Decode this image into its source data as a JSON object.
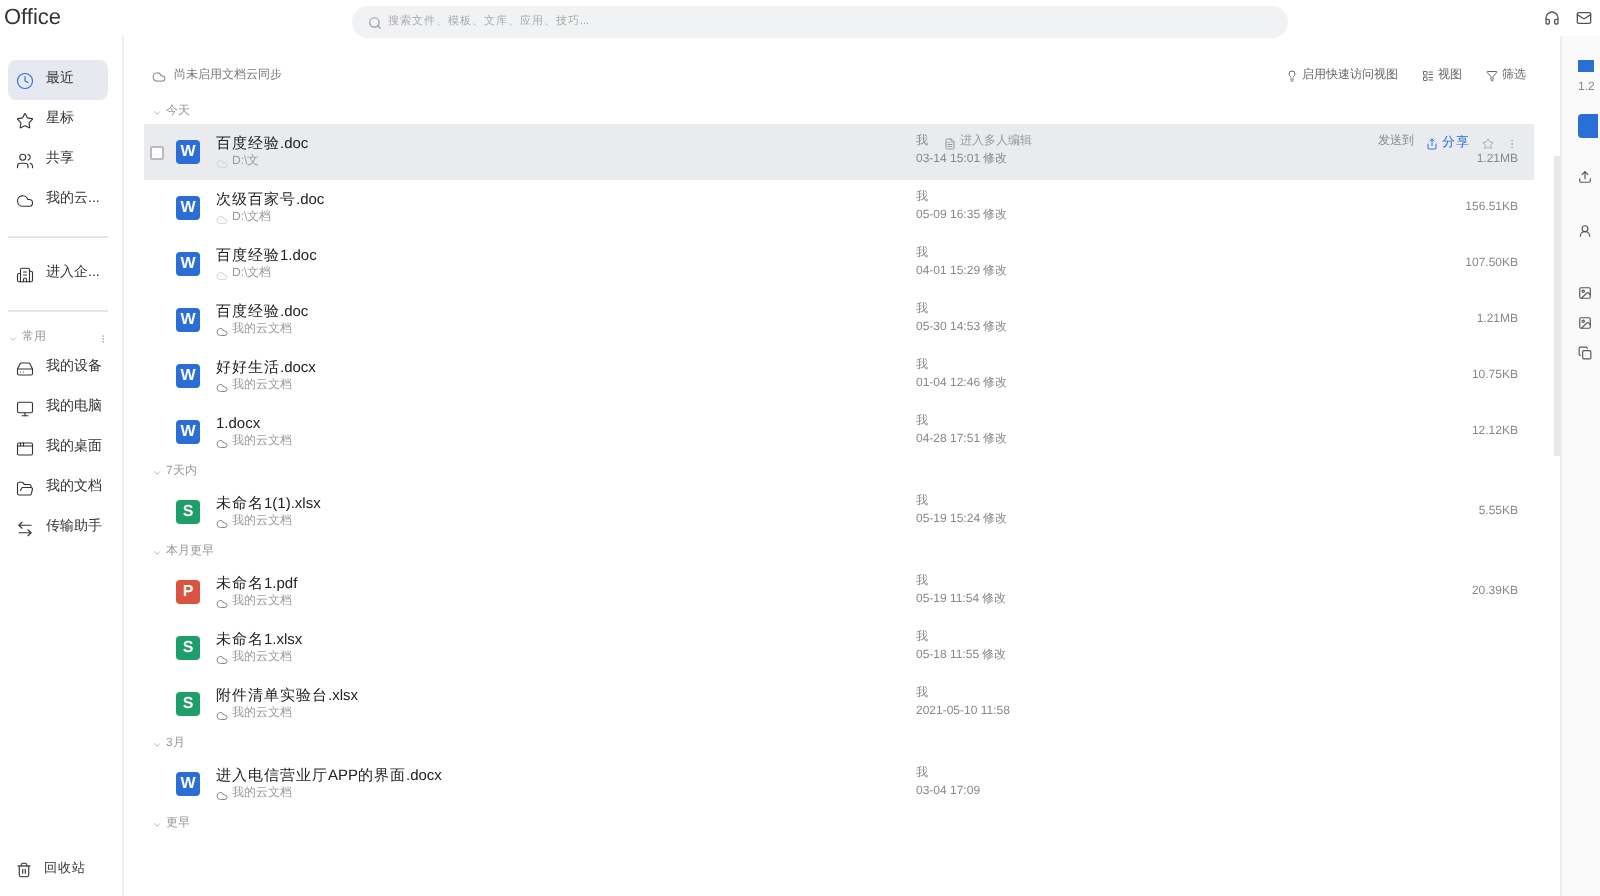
{
  "app": {
    "logo": "Office",
    "search_placeholder": "搜索文件、模板、文库、应用、技巧..."
  },
  "sidebar": {
    "items": [
      {
        "label": "最近",
        "selected": true
      },
      {
        "label": "星标",
        "selected": false
      },
      {
        "label": "共享",
        "selected": false
      },
      {
        "label": "我的云...",
        "selected": false
      }
    ],
    "enterprise": {
      "label": "进入企..."
    },
    "group": {
      "label": "常用",
      "expanded": true,
      "items": [
        {
          "label": "我的设备"
        },
        {
          "label": "我的电脑"
        },
        {
          "label": "我的桌面"
        },
        {
          "label": "我的文档"
        },
        {
          "label": "传输助手"
        }
      ]
    },
    "trash": "回收站"
  },
  "toolbar": {
    "sync": "尚未启用文档云同步",
    "actions": [
      "启用快速访问视图",
      "视图",
      "筛选"
    ]
  },
  "groups": [
    {
      "label": "今天",
      "expanded": true,
      "rows": [
        {
          "kind": "doc",
          "letter": "W",
          "name": "百度经验.doc",
          "location": "D:\\文",
          "cloud": false,
          "owner": "我",
          "time": "03-14 15:01 修改",
          "size": "1.21MB",
          "hovered": true,
          "collab": "进入多人编辑",
          "send": "发送到",
          "share": "分享"
        },
        {
          "kind": "doc",
          "letter": "W",
          "name": "次级百家号.doc",
          "location": "D:\\文档",
          "cloud": false,
          "owner": "我",
          "time": "05-09 16:35 修改",
          "size": "156.51KB",
          "hovered": false
        },
        {
          "kind": "doc",
          "letter": "W",
          "name": "百度经验1.doc",
          "location": "D:\\文档",
          "cloud": false,
          "owner": "我",
          "time": "04-01 15:29 修改",
          "size": "107.50KB",
          "hovered": false
        },
        {
          "kind": "doc",
          "letter": "W",
          "name": "百度经验.doc",
          "location": "我的云文档",
          "cloud": true,
          "owner": "我",
          "time": "05-30 14:53 修改",
          "size": "1.21MB",
          "hovered": false
        },
        {
          "kind": "doc",
          "letter": "W",
          "name": "好好生活.docx",
          "location": "我的云文档",
          "cloud": true,
          "owner": "我",
          "time": "01-04 12:46 修改",
          "size": "10.75KB",
          "hovered": false
        },
        {
          "kind": "doc",
          "letter": "W",
          "name": "1.docx",
          "location": "我的云文档",
          "cloud": true,
          "owner": "我",
          "time": "04-28 17:51 修改",
          "size": "12.12KB",
          "hovered": false
        }
      ]
    },
    {
      "label": "7天内",
      "expanded": true,
      "rows": [
        {
          "kind": "sheet",
          "letter": "S",
          "name": "未命名1(1).xlsx",
          "location": "我的云文档",
          "cloud": true,
          "owner": "我",
          "time": "05-19 15:24 修改",
          "size": "5.55KB",
          "hovered": false
        }
      ]
    },
    {
      "label": "本月更早",
      "expanded": true,
      "rows": [
        {
          "kind": "pdf",
          "letter": "P",
          "name": "未命名1.pdf",
          "location": "我的云文档",
          "cloud": true,
          "owner": "我",
          "time": "05-19 11:54 修改",
          "size": "20.39KB",
          "hovered": false
        },
        {
          "kind": "sheet",
          "letter": "S",
          "name": "未命名1.xlsx",
          "location": "我的云文档",
          "cloud": true,
          "owner": "我",
          "time": "05-18 11:55 修改",
          "hovered": false
        },
        {
          "kind": "sheet",
          "letter": "S",
          "name": "附件清单实验台.xlsx",
          "location": "我的云文档",
          "cloud": true,
          "owner": "我",
          "time": "2021-05-10 11:58",
          "hovered": false
        }
      ]
    },
    {
      "label": "3月",
      "expanded": true,
      "rows": [
        {
          "kind": "doc",
          "letter": "W",
          "name": "进入电信营业厅APP的界面.docx",
          "location": "我的云文档",
          "cloud": true,
          "owner": "我",
          "time": "03-04 17:09",
          "hovered": false
        }
      ]
    },
    {
      "label": "更早",
      "expanded": true
    }
  ],
  "side_panel": {
    "size": "1.2"
  }
}
